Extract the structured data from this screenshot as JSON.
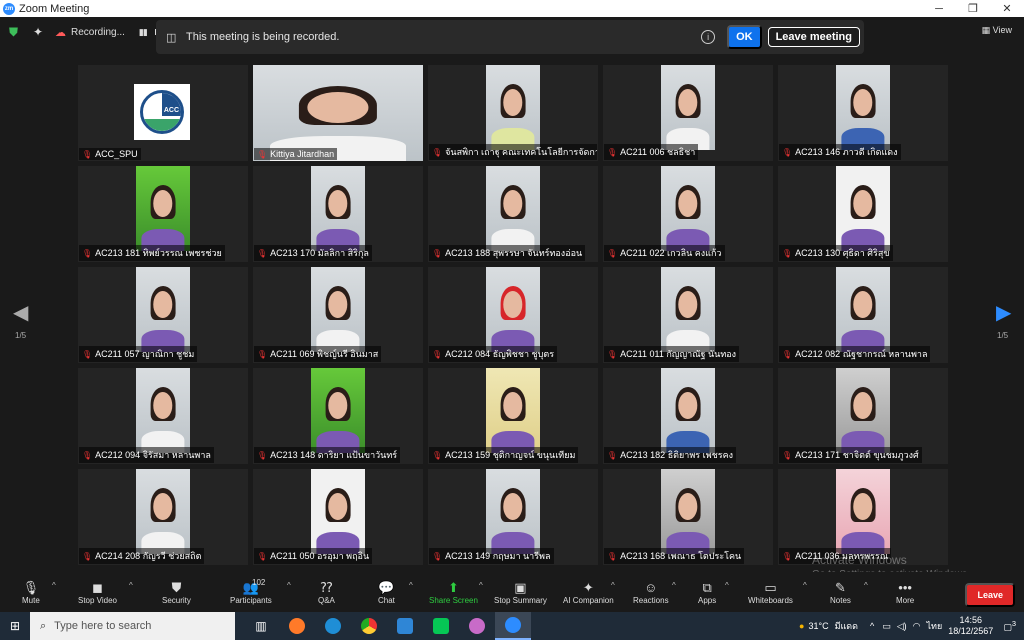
{
  "window": {
    "title": "Zoom Meeting",
    "logo_text": "zm"
  },
  "topbar": {
    "recording_label": "Recording...",
    "view_label": "View"
  },
  "banner": {
    "message": "This meeting is being recorded.",
    "info_glyph": "i",
    "ok_label": "OK",
    "leave_label": "Leave meeting"
  },
  "pagination": {
    "left": "1/5",
    "right": "1/5"
  },
  "participants": [
    {
      "name": "ACC_SPU",
      "type": "logo",
      "logo_text": "ACC"
    },
    {
      "name": "Kittiya Jitardhan",
      "type": "wide",
      "active": true
    },
    {
      "name": "จันสพิกา เถาฐุ คณะเทคโนโลยีการจัดการ",
      "type": "g"
    },
    {
      "name": "AC211 006 ชลธิชา",
      "type": "w"
    },
    {
      "name": "AC213 146 ภาวดี เกิดแดง",
      "type": "bl"
    },
    {
      "name": "AC213 181 ทิพย์วรรณ เพชรช่วย",
      "type": "bg-green"
    },
    {
      "name": "AC213 170 มัลลิกา สิริกุล",
      "type": ""
    },
    {
      "name": "AC213 188 สุพรรษา จันทร์ทองอ่อน",
      "type": "w"
    },
    {
      "name": "AC211 022 เกวลิน คงแก้ว",
      "type": ""
    },
    {
      "name": "AC213 130 ศุธิดา ศิริสุข",
      "type": "bg-white"
    },
    {
      "name": "AC211 057 ญาณิกา ชูชม",
      "type": ""
    },
    {
      "name": "AC211 069 พิชญ์นรี อินมาส",
      "type": "w"
    },
    {
      "name": "AC212 084 ธัญพิชชา ชูบุตร",
      "type": "bg-red"
    },
    {
      "name": "AC211 011 กัญญาณัฐ นันทอง",
      "type": "w"
    },
    {
      "name": "AC212 082 ณัฐชากรณ์ หลานพาล",
      "type": ""
    },
    {
      "name": "AC212 094 จิรัสมา หลานพาล",
      "type": "w"
    },
    {
      "name": "AC213 148 ดาริยา แป้นขาวันทร์",
      "type": "bg-green"
    },
    {
      "name": "AC213 159 ชุติกาญจน์ ขนุนเทียม",
      "type": "bg-yellow"
    },
    {
      "name": "AC213 182 ธิติยาพร เพชรคง",
      "type": "bl"
    },
    {
      "name": "AC213 171 ชาจิตต์ ขุนชมภูวงศ์",
      "type": "bg-concrete"
    },
    {
      "name": "AC214 208 กัญรวี ช่วยสถิต",
      "type": "w"
    },
    {
      "name": "AC211 050 อรอุมา พฤอิน",
      "type": "bg-white"
    },
    {
      "name": "AC213 149 กฤษมา นารีพล",
      "type": ""
    },
    {
      "name": "AC213 168 เพณาธ โตประโคน",
      "type": "bg-concrete"
    },
    {
      "name": "AC211 036 มลทรพรรณ",
      "type": "bg-pink"
    }
  ],
  "toolbar": {
    "mute": "Mute",
    "stop_video": "Stop Video",
    "security": "Security",
    "participants": "Participants",
    "participants_count": "102",
    "qa": "Q&A",
    "chat": "Chat",
    "share_screen": "Share Screen",
    "stop_summary": "Stop Summary",
    "ai_companion": "AI Companion",
    "reactions": "Reactions",
    "apps": "Apps",
    "whiteboards": "Whiteboards",
    "notes": "Notes",
    "more": "More",
    "leave": "Leave"
  },
  "watermark": {
    "line1": "Activate Windows",
    "line2": "Go to Settings to activate Windows."
  },
  "taskbar": {
    "search_placeholder": "Type here to search",
    "temperature": "31°C",
    "weather_text": "มีแดด",
    "language": "ไทย",
    "time": "14:56",
    "date": "18/12/2567",
    "notification_count": "3"
  },
  "colors": {
    "accent": "#0e72ed",
    "active_border": "#c9d94b",
    "leave": "#e02828",
    "share_green": "#2ecc40"
  }
}
